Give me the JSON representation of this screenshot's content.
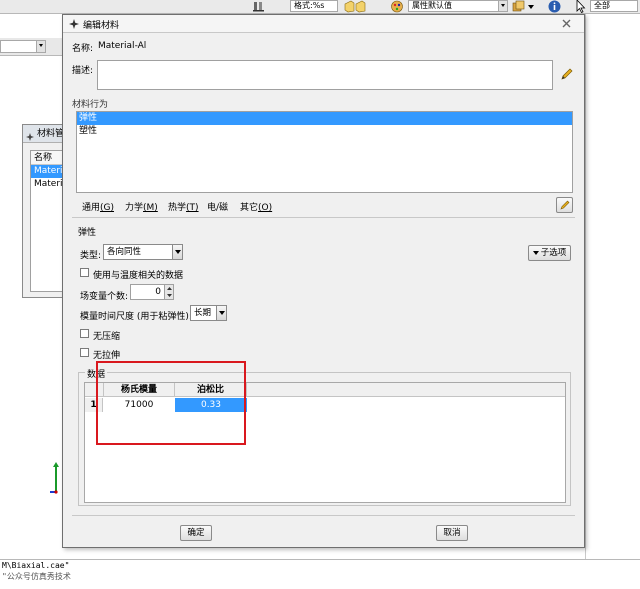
{
  "toolbar": {
    "format_combo": "格式:%s",
    "attribute_combo": "属性默认值",
    "scope_combo": "全部"
  },
  "manager": {
    "title": "材料管",
    "column_header": "名称",
    "rows": [
      "Materi",
      "Materi"
    ]
  },
  "dialog": {
    "title": "编辑材料",
    "name_label": "名称:",
    "name_value": "Material-Al",
    "description_label": "描述:",
    "behavior_section": "材料行为",
    "behaviors": [
      "弹性",
      "塑性"
    ],
    "menus": {
      "general": "通用",
      "general_key": "(G)",
      "mechanical": "力学",
      "mechanical_key": "(M)",
      "thermal": "热学",
      "thermal_key": "(T)",
      "electromagnetic": "电/磁",
      "other": "其它",
      "other_key": "(O)"
    },
    "elastic": {
      "section_title": "弹性",
      "type_label": "类型:",
      "type_value": "各向同性",
      "suboptions_label": "子选项",
      "temp_dependent_label": "使用与温度相关的数据",
      "field_vars_label": "场变量个数:",
      "field_vars_value": "0",
      "moduli_label": "模量时间尺度 (用于粘弹性):",
      "moduli_value": "长期",
      "no_compression_label": "无压缩",
      "no_tension_label": "无拉伸"
    },
    "data": {
      "section_title": "数据",
      "columns": [
        "杨氏模量",
        "泊松比"
      ],
      "rows": [
        {
          "index": "1",
          "youngs_modulus": "71000",
          "poisson_ratio": "0.33"
        }
      ]
    },
    "ok_label": "确定",
    "cancel_label": "取消"
  },
  "messages": {
    "line1": "M\\Biaxial.cae\"",
    "line2": "\"公众号仿真秀技术"
  },
  "colors": {
    "selection": "#3399ff",
    "highlight_box": "#d9181e"
  }
}
